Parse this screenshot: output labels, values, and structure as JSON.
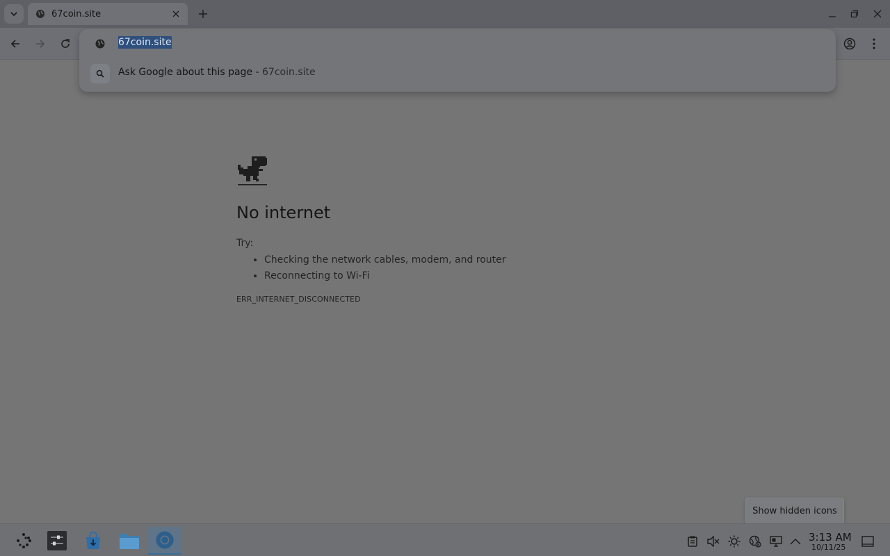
{
  "tabstrip": {
    "active_tab_title": "67coin.site"
  },
  "omnibox": {
    "input_value": "67coin.site",
    "suggestion_text": "Ask Google about this page - ",
    "suggestion_url": "67coin.site"
  },
  "error_page": {
    "title": "No internet",
    "try_label": "Try:",
    "tips": [
      "Checking the network cables, modem, and router",
      "Reconnecting to Wi-Fi"
    ],
    "error_code": "ERR_INTERNET_DISCONNECTED"
  },
  "taskbar": {
    "time": "3:13 AM",
    "date": "10/11/25",
    "tooltip": "Show hidden icons"
  },
  "icons": [
    "tab-search-icon",
    "globe-icon",
    "close-icon",
    "plus-icon",
    "minimize-icon",
    "restore-icon",
    "back-arrow-icon",
    "forward-arrow-icon",
    "reload-icon",
    "search-icon",
    "profile-icon",
    "kebab-menu-icon",
    "dino-icon",
    "launcher-icon",
    "system-settings-icon",
    "discover-store-icon",
    "file-manager-icon",
    "chromium-icon",
    "clipboard-icon",
    "volume-muted-icon",
    "brightness-icon",
    "network-disconnected-icon",
    "display-icon",
    "chevron-up-icon",
    "show-desktop-icon"
  ],
  "colors": {
    "selection": "#2f4f7c",
    "active_task": "#5f7488"
  }
}
